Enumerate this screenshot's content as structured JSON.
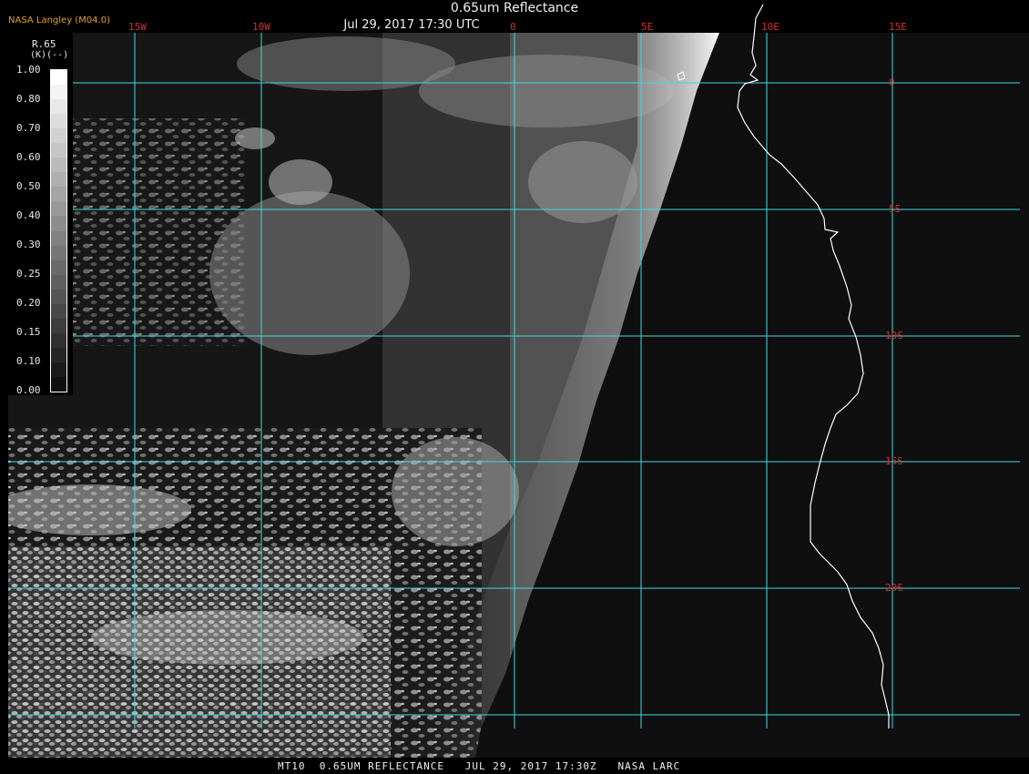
{
  "header": {
    "title": "0.65um Reflectance",
    "datetime": "Jul 29, 2017 17:30 UTC",
    "credit": "NASA Langley (M04.0)"
  },
  "footer": {
    "text": "MT10  0.65UM REFLECTANCE   JUL 29, 2017 17:30Z   NASA LARC"
  },
  "legend": {
    "variable": "R.65",
    "unit": "(K)(--)",
    "ticks": [
      "1.00",
      "0.80",
      "0.70",
      "0.60",
      "0.50",
      "0.40",
      "0.30",
      "0.25",
      "0.20",
      "0.15",
      "0.10",
      "0.00"
    ]
  },
  "grid": {
    "longitude_labels": [
      "15W",
      "10W",
      "0",
      "5E",
      "10E",
      "15E"
    ],
    "latitude_labels": [
      "0",
      "5S",
      "10S",
      "15S",
      "20S"
    ],
    "line_color": "#40d8e0",
    "label_color": "#d23030"
  },
  "colors": {
    "coastline": "#ffffff",
    "background": "#000000",
    "credit": "#e8a020"
  }
}
